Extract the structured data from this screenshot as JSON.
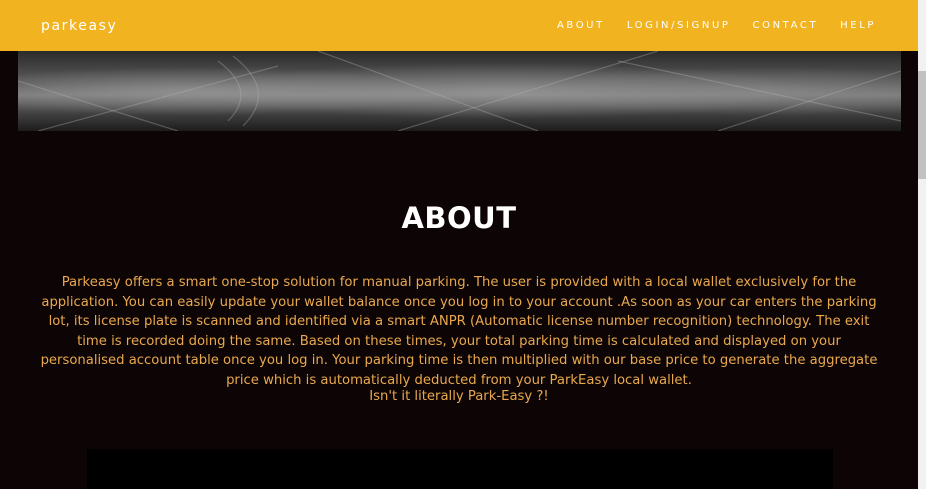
{
  "brand": "parkeasy",
  "nav": {
    "about": "ABOUT",
    "login": "LOGIN/SIGNUP",
    "contact": "CONTACT",
    "help": "HELP"
  },
  "about": {
    "title": "ABOUT",
    "body": "Parkeasy offers a smart one-stop solution for manual parking. The user is provided with a local wallet exclusively for the application. You can easily update your wallet balance once you log in to your account .As soon as your car enters the parking lot, its license plate is scanned and identified via a smart ANPR (Automatic license number recognition) technology. The exit time is recorded doing the same. Based on these times, your total parking time is calculated and displayed on your personalised account table once you log in. Your parking time is then multiplied with our base price to generate the aggregate price which is automatically deducted from your ParkEasy local wallet.",
    "tagline": "Isn't it literally Park-Easy ?!"
  },
  "colors": {
    "navbar": "#f2b321",
    "background": "#0d0505",
    "body_text": "#e9a84d",
    "title": "#ffffff"
  }
}
